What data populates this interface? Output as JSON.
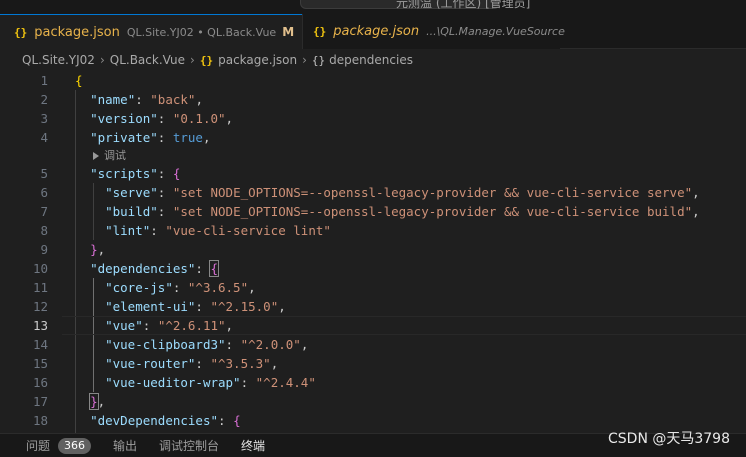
{
  "window": {
    "title_fragment": "元测温 (工作区) [管理员]"
  },
  "tabs": [
    {
      "name": "package.json",
      "desc": "QL.Site.YJ02 • QL.Back.Vue",
      "modified": "M",
      "close": "×"
    },
    {
      "name": "package.json",
      "desc": "...\\QL.Manage.VueSource"
    }
  ],
  "breadcrumb": [
    "QL.Site.YJ02",
    "QL.Back.Vue",
    "package.json",
    "dependencies"
  ],
  "editor": {
    "codelens": "调试",
    "lines": [
      {
        "n": "1"
      },
      {
        "n": "2"
      },
      {
        "n": "3"
      },
      {
        "n": "4"
      },
      {
        "n": "5"
      },
      {
        "n": "6"
      },
      {
        "n": "7"
      },
      {
        "n": "8"
      },
      {
        "n": "9"
      },
      {
        "n": "10"
      },
      {
        "n": "11"
      },
      {
        "n": "12"
      },
      {
        "n": "13"
      },
      {
        "n": "14"
      },
      {
        "n": "15"
      },
      {
        "n": "16"
      },
      {
        "n": "17"
      },
      {
        "n": "18"
      }
    ],
    "name_key": "\"name\"",
    "name_val": "\"back\"",
    "version_key": "\"version\"",
    "version_val": "\"0.1.0\"",
    "private_key": "\"private\"",
    "private_val": "true",
    "scripts_key": "\"scripts\"",
    "serve_key": "\"serve\"",
    "serve_val": "\"set NODE_OPTIONS=--openssl-legacy-provider && vue-cli-service serve\"",
    "build_key": "\"build\"",
    "build_val": "\"set NODE_OPTIONS=--openssl-legacy-provider && vue-cli-service build\"",
    "lint_key": "\"lint\"",
    "lint_val": "\"vue-cli-service lint\"",
    "deps_key": "\"dependencies\"",
    "corejs_key": "\"core-js\"",
    "corejs_val": "\"^3.6.5\"",
    "element_key": "\"element-ui\"",
    "element_val": "\"^2.15.0\"",
    "vue_key": "\"vue\"",
    "vue_val": "\"^2.6.11\"",
    "clip_key": "\"vue-clipboard3\"",
    "clip_val": "\"^2.0.0\"",
    "router_key": "\"vue-router\"",
    "router_val": "\"^3.5.3\"",
    "ueditor_key": "\"vue-ueditor-wrap\"",
    "ueditor_val": "\"^2.4.4\"",
    "devdeps_key": "\"devDependencies\""
  },
  "panel": {
    "problems": "问题",
    "problems_count": "366",
    "output": "输出",
    "debug_console": "调试控制台",
    "terminal": "终端"
  },
  "watermark": "CSDN @天马3798"
}
